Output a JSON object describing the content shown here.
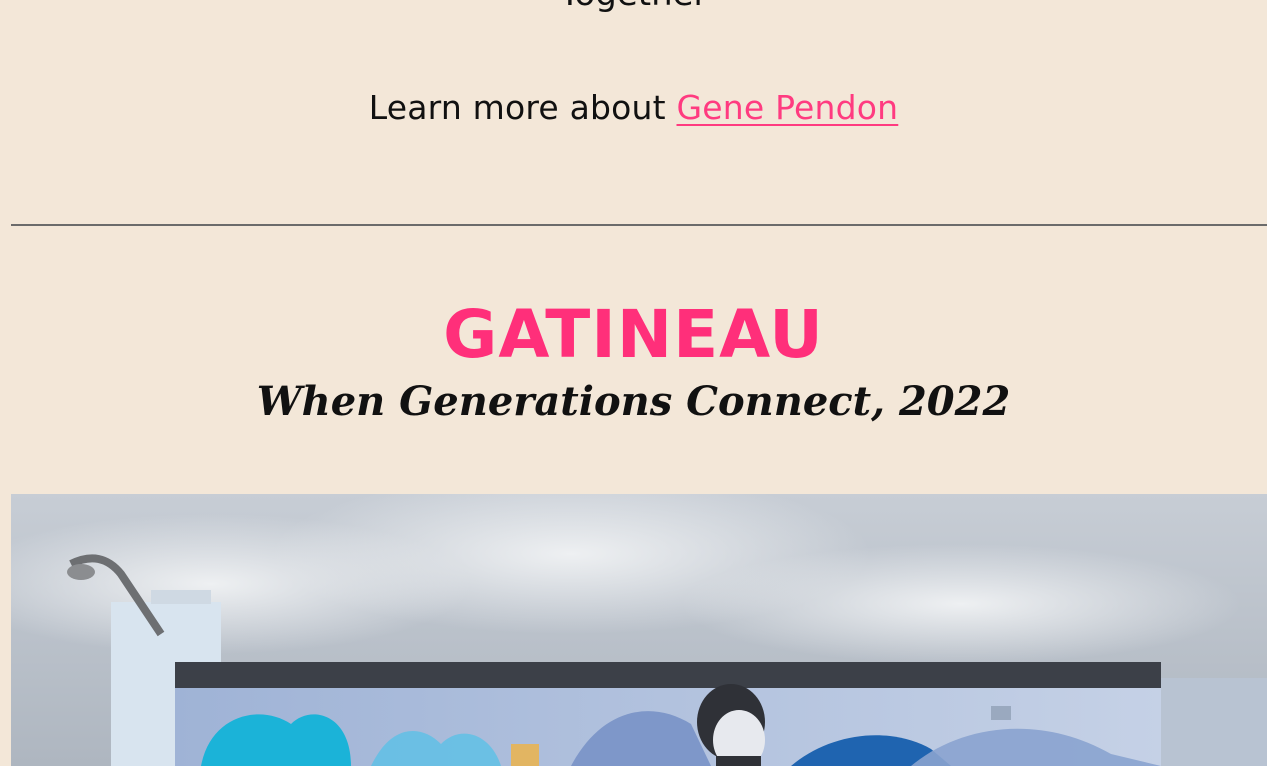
{
  "top_text": {
    "partial_line": "Together"
  },
  "learn_more": {
    "prefix": "Learn more about ",
    "link_label": "Gene Pendon",
    "link_color": "#ff3b80"
  },
  "section": {
    "city": "GATINEAU",
    "artwork_title": "When Generations Connect, 2022",
    "accent_color": "#ff2f7a",
    "background": "#f3e7d8"
  },
  "photo": {
    "subject": "mural-on-building"
  }
}
